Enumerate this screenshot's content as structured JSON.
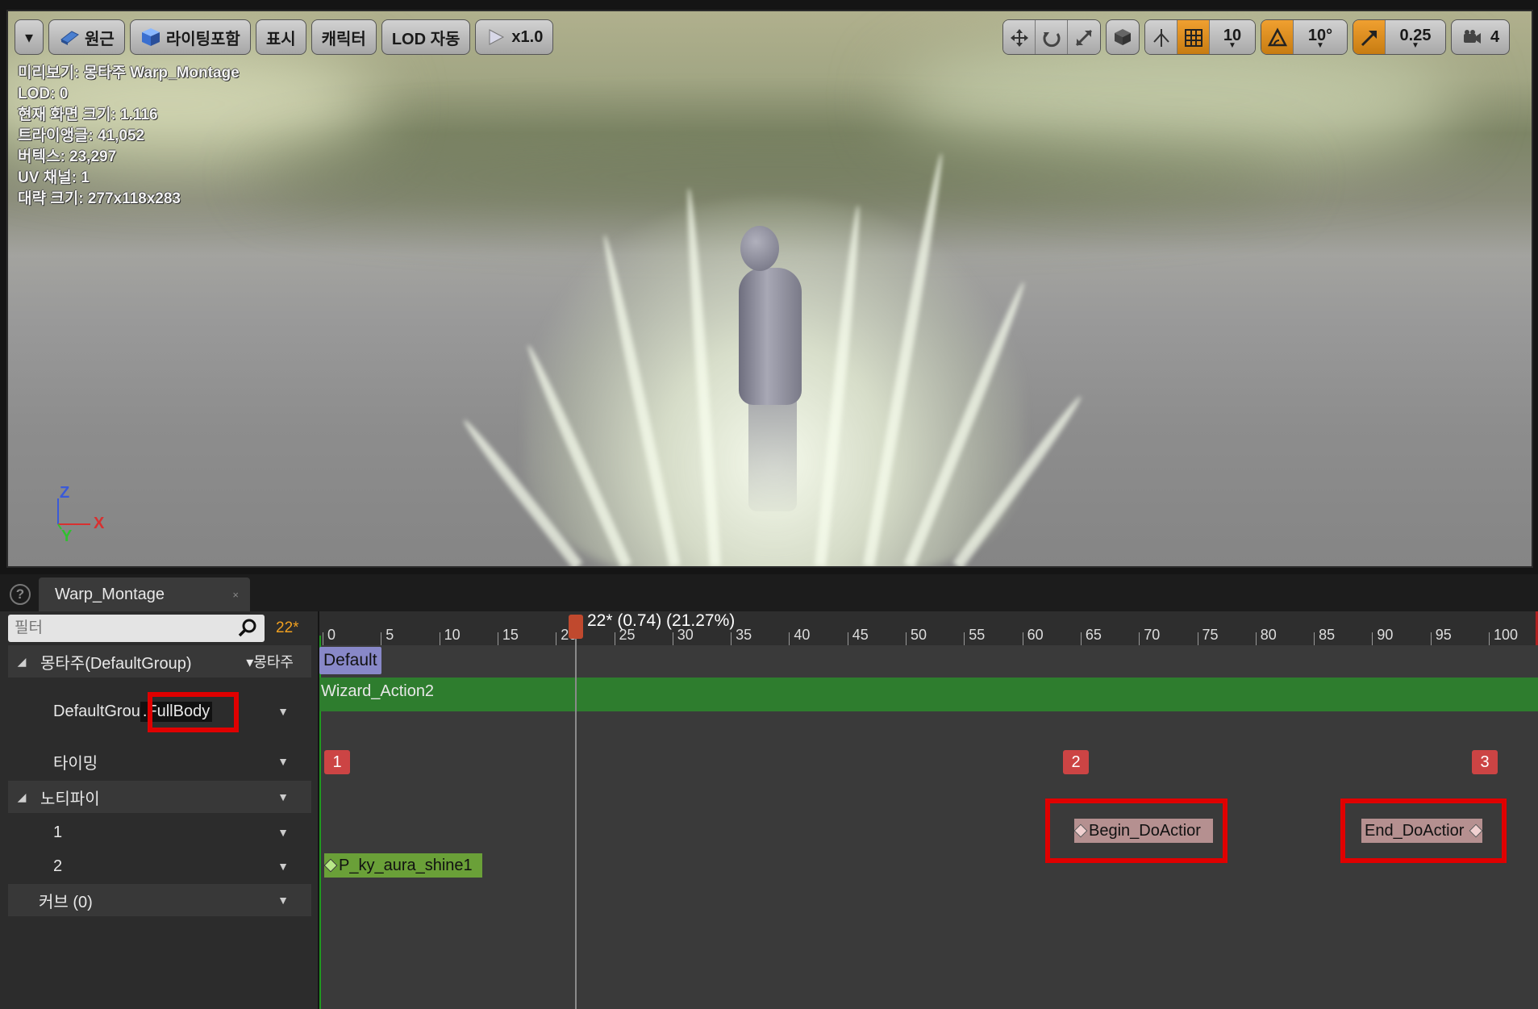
{
  "toolbar": {
    "menu_label": "▾",
    "perspective_label": "원근",
    "lighting_label": "라이팅포함",
    "show_label": "표시",
    "character_label": "캐릭터",
    "lod_label": "LOD 자동",
    "speed_label": "x1.0",
    "grid_snap_value": "10",
    "rotation_snap_value": "10°",
    "scale_snap_value": "0.25",
    "camera_speed_value": "4"
  },
  "viewport_stats": {
    "preview": "미리보기: 몽타주 Warp_Montage",
    "lod": "LOD: 0",
    "screen_size": "현재 화면 크기: 1.116",
    "triangles": "트라이앵글: 41,052",
    "vertices": "버텍스: 23,297",
    "uv_channels": "UV 채널: 1",
    "approx_size": "대략 크기: 277x118x283"
  },
  "axis": {
    "z": "Z",
    "x": "X",
    "y": "Y"
  },
  "tab": {
    "title": "Warp_Montage",
    "close": "×",
    "help": "?"
  },
  "left_panel": {
    "filter_placeholder": "필터",
    "current_frame": "22*",
    "montage_header": "몽타주(DefaultGroup)",
    "montage_menu": "▾몽타주",
    "slot_prefix": "DefaultGrou",
    "slot_name": ".FullBody",
    "timing": "타이밍",
    "notifies": "노티파이",
    "notify_track_1": "1",
    "notify_track_2": "2",
    "curves": "커브 (0)"
  },
  "timeline": {
    "readout": "22* (0.74) (21.27%)",
    "ticks": [
      "0",
      "5",
      "10",
      "15",
      "20",
      "25",
      "30",
      "35",
      "40",
      "45",
      "50",
      "55",
      "60",
      "65",
      "70",
      "75",
      "80",
      "85",
      "90",
      "95",
      "100"
    ],
    "section_label": "Default",
    "segment_label": "Wizard_Action2",
    "markers": [
      "1",
      "2",
      "3"
    ],
    "notifies": {
      "begin": "Begin_DoActior",
      "end": "End_DoActior",
      "particle": "P_ky_aura_shine1"
    }
  },
  "colors": {
    "accent_orange": "#f0a030",
    "section_blue": "#8888c8",
    "segment_green": "#2e7d2e",
    "marker_red": "#cc4444",
    "highlight_red": "#e00000"
  }
}
